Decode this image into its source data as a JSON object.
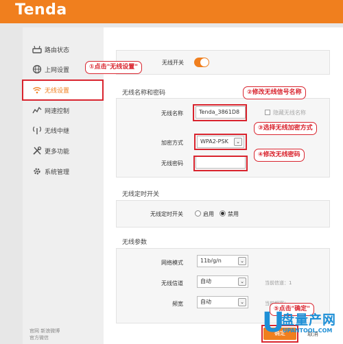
{
  "brand": {
    "logo_text": "Tenda"
  },
  "sidebar": {
    "items": [
      {
        "label": "路由状态",
        "icon": "router-status-icon"
      },
      {
        "label": "上网设置",
        "icon": "globe-icon"
      },
      {
        "label": "无线设置",
        "icon": "wifi-icon",
        "active": true
      },
      {
        "label": "网速控制",
        "icon": "speed-chart-icon"
      },
      {
        "label": "无线中继",
        "icon": "antenna-icon"
      },
      {
        "label": "更多功能",
        "icon": "tools-icon"
      },
      {
        "label": "系统管理",
        "icon": "gear-icon"
      }
    ],
    "footer": {
      "line1": "官网  新浪微博",
      "line2": "官方微信"
    }
  },
  "wifi_switch": {
    "label": "无线开关",
    "on": true
  },
  "section_ssid": {
    "title": "无线名称和密码",
    "ssid_label": "无线名称",
    "ssid_value": "Tenda_3861D8",
    "hide_label": "隐藏无线名称",
    "encrypt_label": "加密方式",
    "encrypt_value": "WPA2-PSK",
    "password_label": "无线密码",
    "password_value": ""
  },
  "section_timer": {
    "title": "无线定时开关",
    "row_label": "无线定时开关",
    "opt_enable": "启用",
    "opt_disable": "禁用",
    "selected": "禁用"
  },
  "section_params": {
    "title": "无线参数",
    "mode_label": "网络模式",
    "mode_value": "11b/g/n",
    "channel_label": "无线信道",
    "channel_value": "自动",
    "channel_hint": "当前信道：1",
    "bandwidth_label": "频宽",
    "bandwidth_value": "自动",
    "bandwidth_hint": "当前频宽："
  },
  "buttons": {
    "ok": "确定",
    "cancel": "取消"
  },
  "callouts": {
    "c1": "①点击\"无线设置\"",
    "c2": "②修改无线信号名称",
    "c3": "③选择无线加密方式",
    "c4": "④修改无线密码",
    "c5": "⑤点击\"确定\""
  },
  "watermark": {
    "letter": "U",
    "cn": "盘量产网",
    "url": "UPANTOOL.COM"
  },
  "colors": {
    "accent": "#f07f1e",
    "annotation": "#d9232d",
    "watermark": "#1e8fd6"
  }
}
